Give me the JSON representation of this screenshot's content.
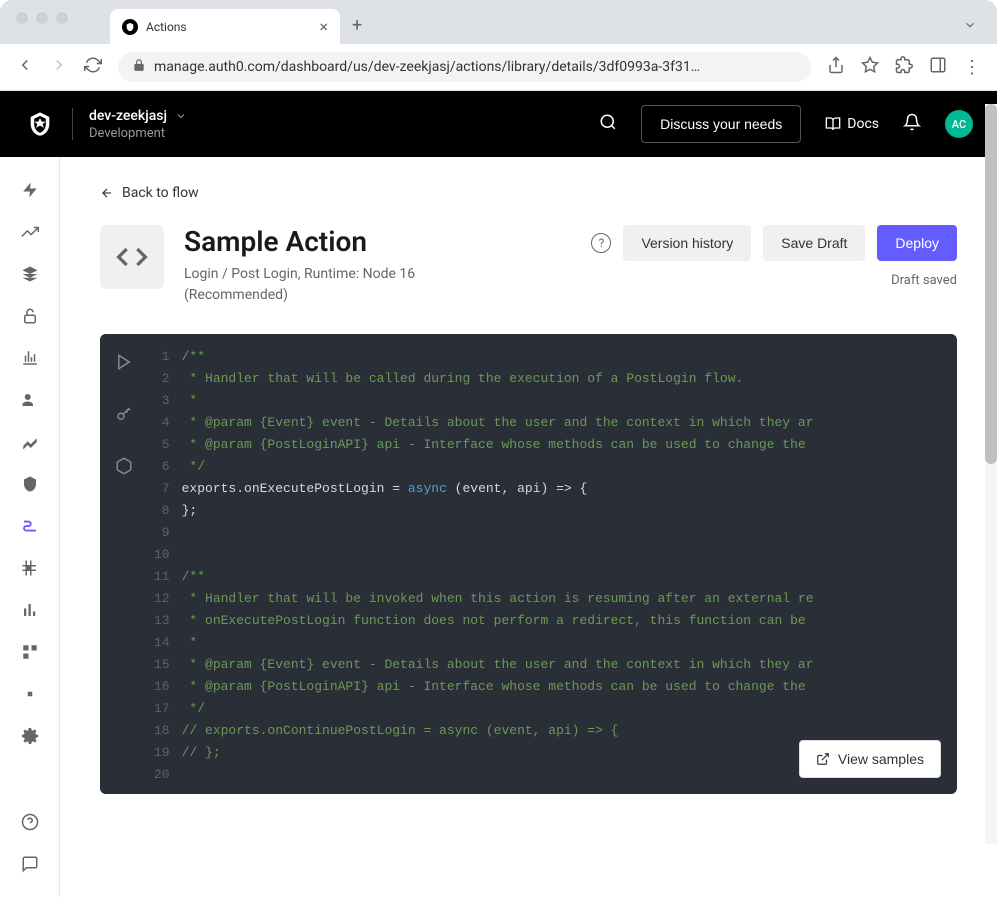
{
  "browser": {
    "tab_title": "Actions",
    "url": "manage.auth0.com/dashboard/us/dev-zeekjasj/actions/library/details/3df0993a-3f31…"
  },
  "header": {
    "tenant_name": "dev-zeekjasj",
    "environment": "Development",
    "discuss_button": "Discuss your needs",
    "docs_label": "Docs",
    "avatar_initials": "AC"
  },
  "page": {
    "back_label": "Back to flow",
    "title": "Sample Action",
    "subtitle": "Login / Post Login, Runtime: Node 16 (Recommended)",
    "version_history": "Version history",
    "save_draft": "Save Draft",
    "deploy": "Deploy",
    "draft_status": "Draft saved",
    "view_samples": "View samples"
  },
  "code": {
    "lines": [
      "/**",
      " * Handler that will be called during the execution of a PostLogin flow.",
      " *",
      " * @param {Event} event - Details about the user and the context in which they ar",
      " * @param {PostLoginAPI} api - Interface whose methods can be used to change the ",
      " */",
      "exports.onExecutePostLogin = async (event, api) => {",
      "};",
      "",
      "",
      "/**",
      " * Handler that will be invoked when this action is resuming after an external re",
      " * onExecutePostLogin function does not perform a redirect, this function can be ",
      " *",
      " * @param {Event} event - Details about the user and the context in which they ar",
      " * @param {PostLoginAPI} api - Interface whose methods can be used to change the ",
      " */",
      "// exports.onContinuePostLogin = async (event, api) => {",
      "// };",
      ""
    ]
  }
}
